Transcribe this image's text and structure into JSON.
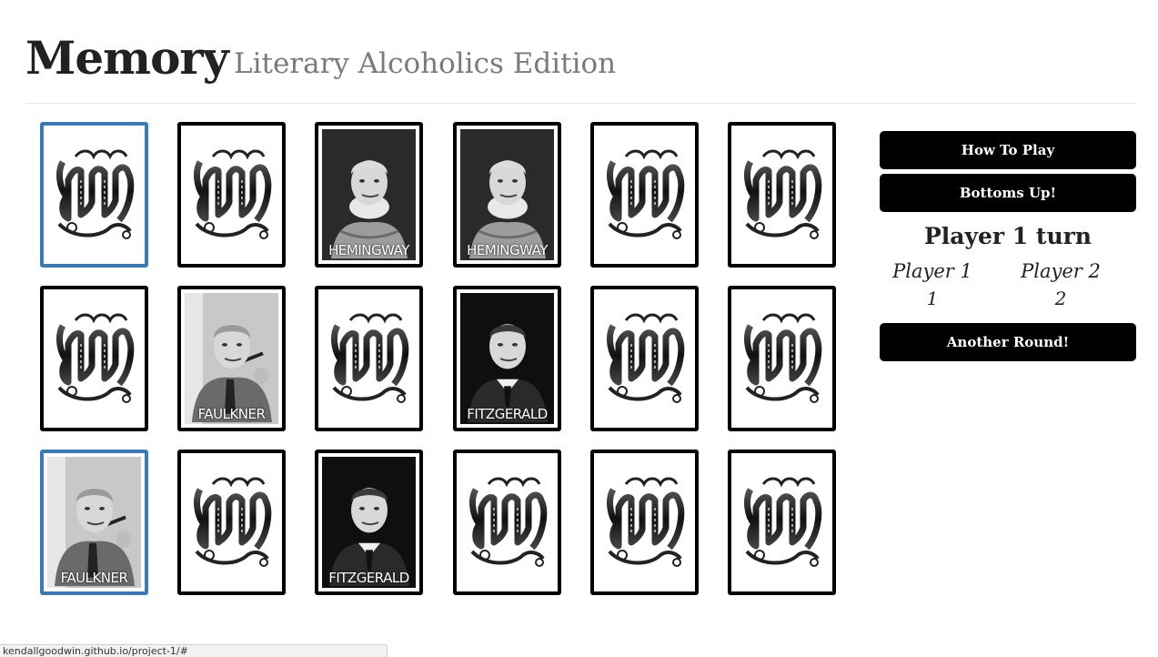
{
  "header": {
    "title": "Memory",
    "subtitle": "Literary Alcoholics Edition"
  },
  "board": {
    "rows": 3,
    "cols": 6,
    "back_icon": "ornate-m-icon",
    "cards": [
      {
        "state": "back",
        "selected": true
      },
      {
        "state": "back",
        "selected": false
      },
      {
        "state": "face",
        "author": "HEMINGWAY",
        "portrait": "hemingway-portrait",
        "selected": false
      },
      {
        "state": "face",
        "author": "HEMINGWAY",
        "portrait": "hemingway-portrait",
        "selected": false
      },
      {
        "state": "back",
        "selected": false
      },
      {
        "state": "back",
        "selected": false
      },
      {
        "state": "back",
        "selected": false
      },
      {
        "state": "face",
        "author": "FAULKNER",
        "portrait": "faulkner-portrait",
        "selected": false
      },
      {
        "state": "back",
        "selected": false
      },
      {
        "state": "face",
        "author": "FITZGERALD",
        "portrait": "fitzgerald-portrait",
        "selected": false
      },
      {
        "state": "back",
        "selected": false
      },
      {
        "state": "back",
        "selected": false
      },
      {
        "state": "face",
        "author": "FAULKNER",
        "portrait": "faulkner-portrait",
        "selected": true
      },
      {
        "state": "back",
        "selected": false
      },
      {
        "state": "face",
        "author": "FITZGERALD",
        "portrait": "fitzgerald-portrait",
        "selected": false
      },
      {
        "state": "back",
        "selected": false
      },
      {
        "state": "back",
        "selected": false
      },
      {
        "state": "back",
        "selected": false
      }
    ]
  },
  "sidebar": {
    "how_to_play_label": "How To Play",
    "bottoms_up_label": "Bottoms Up!",
    "turn_text": "Player 1 turn",
    "players": [
      {
        "name": "Player 1",
        "score": "1"
      },
      {
        "name": "Player 2",
        "score": "2"
      }
    ],
    "another_round_label": "Another Round!"
  },
  "status_bar": {
    "url": "kendallgoodwin.github.io/project-1/#"
  },
  "colors": {
    "selected_border": "#3a7ab8",
    "card_border": "#000000",
    "button_bg": "#000000",
    "button_text": "#ffffff",
    "subtitle": "#7a7a7a"
  }
}
